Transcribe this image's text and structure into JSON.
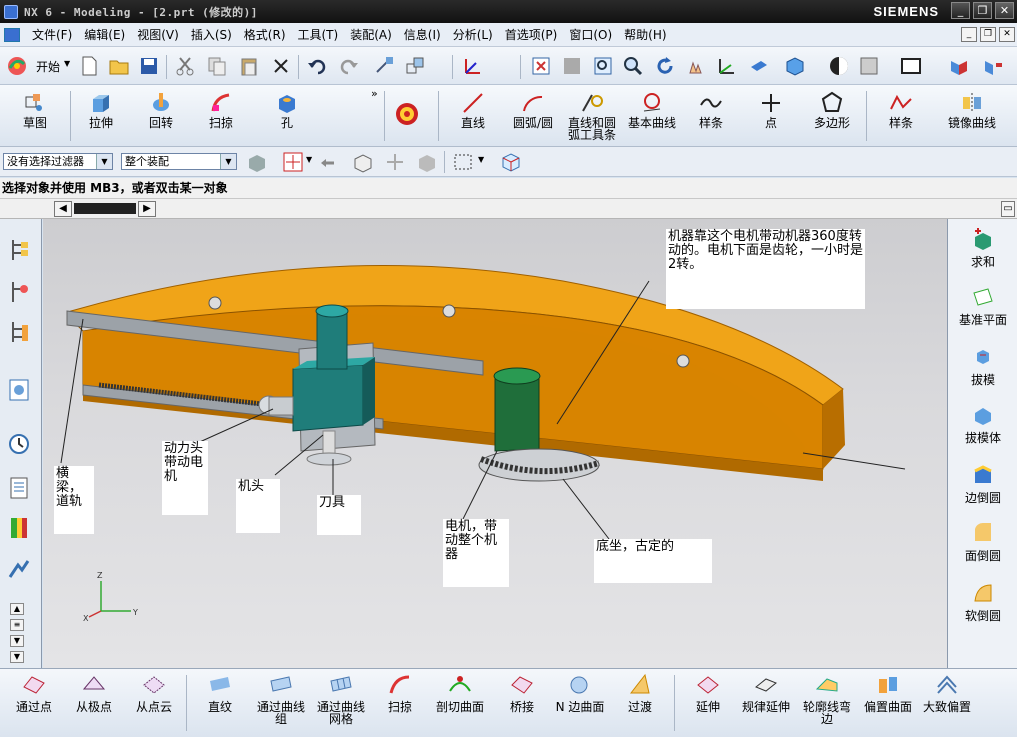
{
  "window": {
    "title": "NX 6 - Modeling - [2.prt (修改的)]",
    "brand": "SIEMENS",
    "controls": [
      "_",
      "❐",
      "✕"
    ]
  },
  "menu": [
    "文件(F)",
    "编辑(E)",
    "视图(V)",
    "插入(S)",
    "格式(R)",
    "工具(T)",
    "装配(A)",
    "信息(I)",
    "分析(L)",
    "首选项(P)",
    "窗口(O)",
    "帮助(H)"
  ],
  "toolbar_standard": {
    "start_label": "开始"
  },
  "toolbar_features": [
    {
      "label": "草图",
      "icon": "sketch-icon"
    },
    {
      "label": "拉伸",
      "icon": "extrude-icon"
    },
    {
      "label": "回转",
      "icon": "revolve-icon"
    },
    {
      "label": "扫掠",
      "icon": "sweep-icon"
    },
    {
      "label": "孔",
      "icon": "hole-icon"
    },
    {
      "label": "直线",
      "icon": "line-icon"
    },
    {
      "label": "圆弧/圆",
      "icon": "arc-icon"
    },
    {
      "label": "直线和圆弧工具条",
      "icon": "line-arc-toolbar-icon"
    },
    {
      "label": "基本曲线",
      "icon": "basic-curve-icon"
    },
    {
      "label": "样条",
      "icon": "spline-icon"
    },
    {
      "label": "点",
      "icon": "point-icon"
    },
    {
      "label": "多边形",
      "icon": "polygon-icon"
    },
    {
      "label": "样条",
      "icon": "spline2-icon"
    },
    {
      "label": "镜像曲线",
      "icon": "mirror-curve-icon"
    }
  ],
  "selection": {
    "filter": "没有选择过滤器",
    "scope": "整个装配"
  },
  "cue_line": "选择对象并使用 MB3，或者双击某一对象",
  "annotations": {
    "motor_note": "机器靠这个电机带动机器360度转动的。电机下面是齿轮，一小时是2转。",
    "beam": "横梁，道轨",
    "power_head": "动力头带动电机",
    "machine_head": "机头",
    "tool": "刀具",
    "motor": "电机，带动整个机器",
    "base": "底坐，古定的"
  },
  "axes": {
    "x": "X",
    "y": "Y",
    "z": "Z"
  },
  "right_tools": [
    {
      "label": "求和",
      "icon": "unite-icon"
    },
    {
      "label": "基准平面",
      "icon": "datum-plane-icon"
    },
    {
      "label": "拔模",
      "icon": "draft-icon"
    },
    {
      "label": "拔模体",
      "icon": "draft-body-icon"
    },
    {
      "label": "边倒圆",
      "icon": "edge-blend-icon"
    },
    {
      "label": "面倒圆",
      "icon": "face-blend-icon"
    },
    {
      "label": "软倒圆",
      "icon": "soft-blend-icon"
    }
  ],
  "bottom_tools": [
    {
      "label": "通过点",
      "icon": "through-points-icon"
    },
    {
      "label": "从极点",
      "icon": "from-poles-icon"
    },
    {
      "label": "从点云",
      "icon": "point-cloud-icon"
    },
    {
      "label": "直纹",
      "icon": "ruled-icon"
    },
    {
      "label": "通过曲线组",
      "icon": "through-curves-icon"
    },
    {
      "label": "通过曲线网格",
      "icon": "curve-mesh-icon"
    },
    {
      "label": "扫掠",
      "icon": "sweep2-icon"
    },
    {
      "label": "剖切曲面",
      "icon": "section-surface-icon"
    },
    {
      "label": "桥接",
      "icon": "bridge-icon"
    },
    {
      "label": "N 边曲面",
      "icon": "n-sided-icon"
    },
    {
      "label": "过渡",
      "icon": "transition-icon"
    },
    {
      "label": "延伸",
      "icon": "extension-icon"
    },
    {
      "label": "规律延伸",
      "icon": "law-extension-icon"
    },
    {
      "label": "轮廓线弯边",
      "icon": "profile-flange-icon"
    },
    {
      "label": "偏置曲面",
      "icon": "offset-surface-icon"
    },
    {
      "label": "大致偏置",
      "icon": "rough-offset-icon"
    }
  ],
  "colors": {
    "body": "#d98400",
    "top": "#f0a418",
    "motor": "#1f6e3a",
    "head": "#1f7d7a",
    "rail": "#9ca2a8"
  }
}
